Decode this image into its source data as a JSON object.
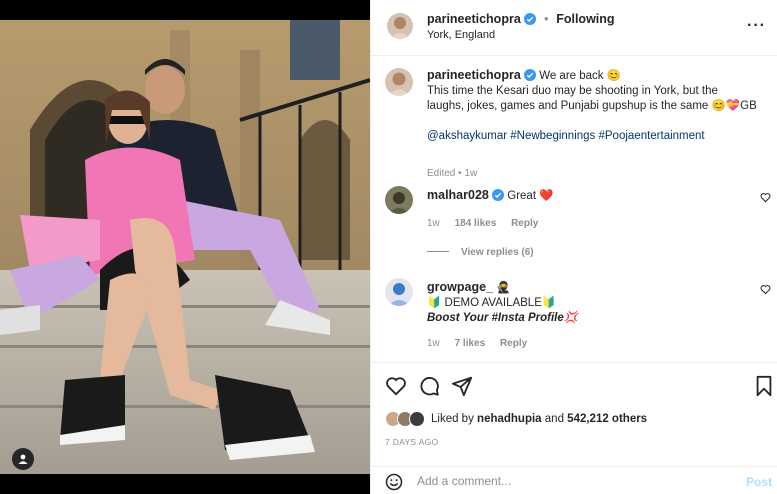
{
  "post": {
    "author": "parineetichopra",
    "follow_status": "Following",
    "location": "York, England",
    "more_icon": "more-horizontal-icon"
  },
  "caption": {
    "username": "parineetichopra",
    "text_line1": "We are back 😊",
    "text_line2": "This time the Kesari duo may be shooting in York, but the laughs, jokes, games and Punjabi gupshup is the same 😊💝GB",
    "hashtags": "@akshaykumar #Newbeginnings #Poojaentertainment",
    "edited": "Edited",
    "time": "1w"
  },
  "comments": [
    {
      "username": "malhar028",
      "text": "Great ❤️",
      "time": "1w",
      "likes": "184 likes",
      "reply": "Reply",
      "view_replies": "View replies (6)"
    },
    {
      "username": "growpage_",
      "username_emoji": "🥷",
      "text_line1": "🔰 DEMO AVAILABLE🔰",
      "text_line2": "Boost Your #Insta Profile💢",
      "time": "1w",
      "likes": "7 likes",
      "reply": "Reply"
    }
  ],
  "actions": {
    "icons": [
      "heart-icon",
      "comment-icon",
      "share-icon",
      "bookmark-icon"
    ]
  },
  "likes": {
    "prefix": "Liked by",
    "user": "nehadhupia",
    "connector": "and",
    "others": "542,212 others"
  },
  "timestamp": "7 DAYS AGO",
  "add_comment": {
    "placeholder": "Add a comment...",
    "post_label": "Post"
  },
  "colors": {
    "verified": "#3897f0",
    "link": "#00376b",
    "muted": "#8e8e8e",
    "like_red": "#ed4956",
    "post_disabled": "#b2dffc"
  }
}
